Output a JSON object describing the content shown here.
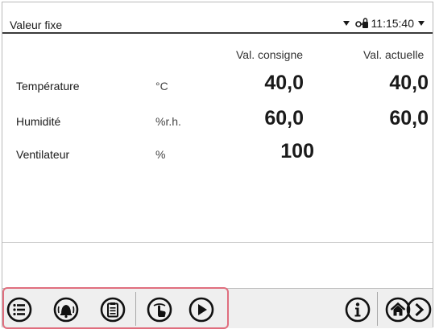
{
  "header": {
    "title": "Valeur fixe",
    "time": "11:15:40"
  },
  "columns": {
    "setpoint": "Val. consigne",
    "actual": "Val. actuelle"
  },
  "rows": [
    {
      "name": "Température",
      "unit": "°C",
      "setpoint": "40,0",
      "actual": "40,0"
    },
    {
      "name": "Humidité",
      "unit": "%r.h.",
      "setpoint": "60,0",
      "actual": "60,0"
    },
    {
      "name": "Ventilateur",
      "unit": "%",
      "setpoint": "100",
      "actual": ""
    }
  ],
  "toolbar": {
    "icons": [
      "list-menu-icon",
      "alarm-bell-icon",
      "clipboard-icon",
      "touch-hand-icon",
      "play-icon",
      "info-icon",
      "home-icon",
      "next-icon"
    ]
  },
  "colors": {
    "highlight": "#e06e7e",
    "toolbar_bg": "#efefef"
  }
}
